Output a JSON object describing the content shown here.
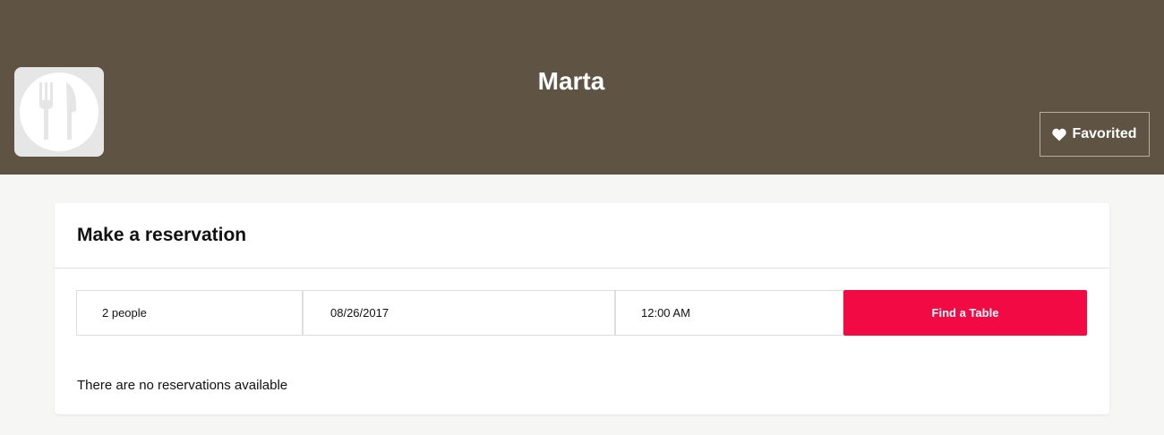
{
  "header": {
    "restaurant_name": "Marta",
    "logo_icon": "fork-knife-icon",
    "favorite_label": "Favorited",
    "favorite_icon": "heart-icon",
    "background_color": "#5f5443"
  },
  "reservation": {
    "title": "Make a reservation",
    "party_size": "2 people",
    "date": "08/26/2017",
    "time": "12:00 AM",
    "find_button_label": "Find a Table",
    "accent_color": "#f20a44",
    "status_message": "There are no reservations available"
  }
}
